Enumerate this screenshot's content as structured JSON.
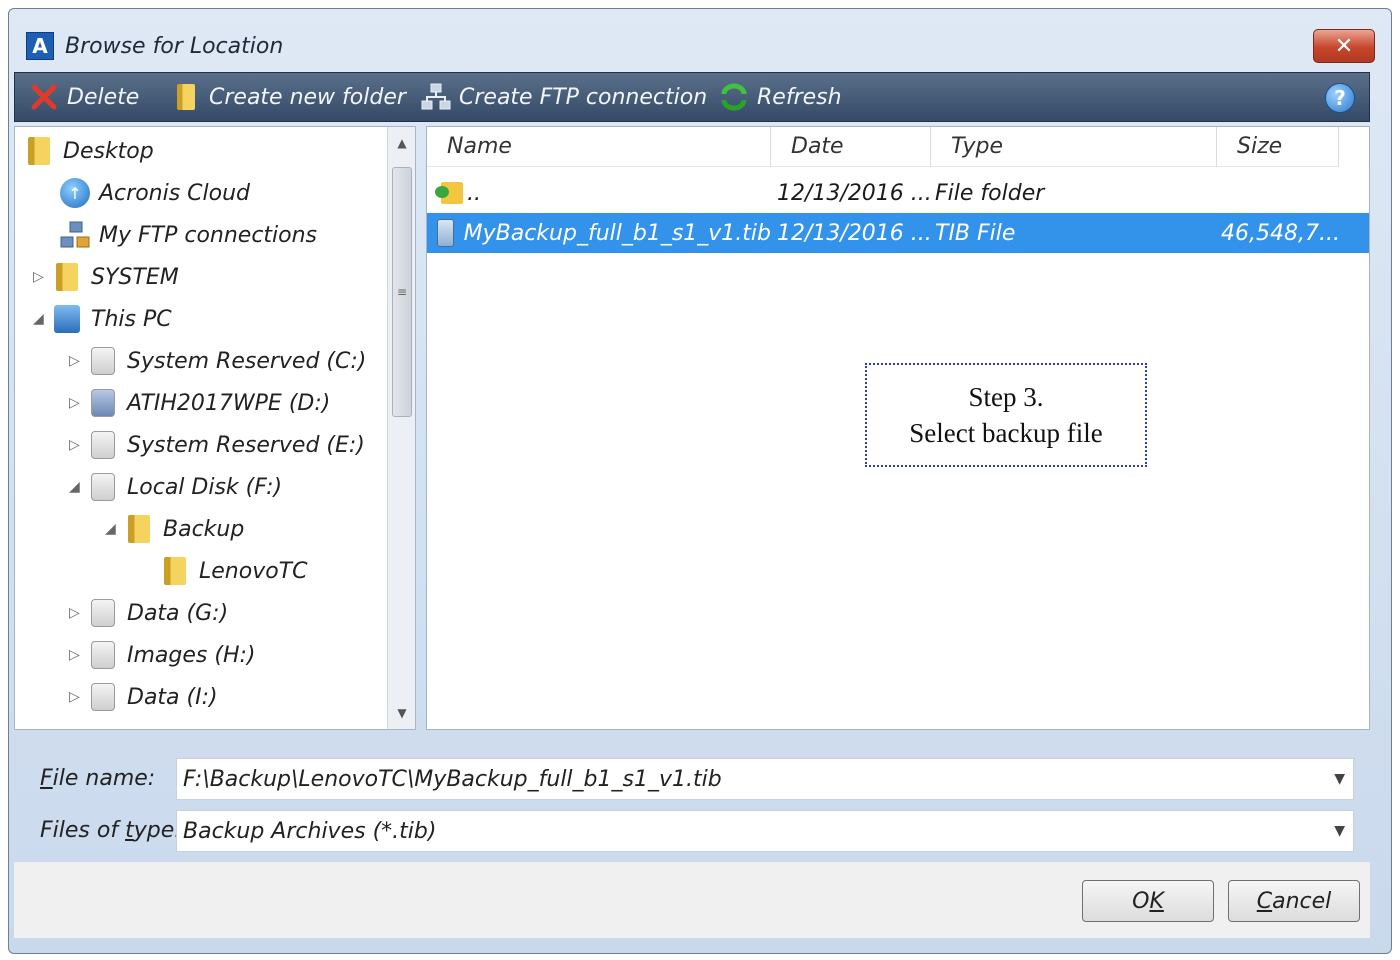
{
  "window": {
    "title": "Browse for Location",
    "app_icon_letter": "A",
    "close_glyph": "✕"
  },
  "toolbar": {
    "delete_label": "Delete",
    "new_folder_label": "Create new folder",
    "ftp_label": "Create FTP connection",
    "refresh_label": "Refresh",
    "help_glyph": "?"
  },
  "tree": {
    "items": [
      {
        "label": "Desktop",
        "icon": "folder-icon",
        "expander": ""
      },
      {
        "label": "Acronis Cloud",
        "icon": "cloud-icon",
        "expander": ""
      },
      {
        "label": "My FTP connections",
        "icon": "ftp-icon",
        "expander": ""
      },
      {
        "label": "SYSTEM",
        "icon": "folder-icon",
        "expander": "▷"
      },
      {
        "label": "This PC",
        "icon": "computer-icon",
        "expander": "◢"
      },
      {
        "label": "System Reserved (C:)",
        "icon": "drive-icon",
        "expander": "▷"
      },
      {
        "label": "ATIH2017WPE (D:)",
        "icon": "drive-icon",
        "expander": "▷"
      },
      {
        "label": "System Reserved (E:)",
        "icon": "drive-icon",
        "expander": "▷"
      },
      {
        "label": "Local Disk (F:)",
        "icon": "drive-icon",
        "expander": "◢"
      },
      {
        "label": "Backup",
        "icon": "folder-icon",
        "expander": "◢"
      },
      {
        "label": "LenovoTC",
        "icon": "folder-icon",
        "expander": ""
      },
      {
        "label": "Data (G:)",
        "icon": "drive-icon",
        "expander": "▷"
      },
      {
        "label": "Images (H:)",
        "icon": "drive-icon",
        "expander": "▷"
      },
      {
        "label": "Data (I:)",
        "icon": "drive-icon",
        "expander": "▷"
      }
    ],
    "scroll_up_glyph": "▲",
    "scroll_down_glyph": "▼",
    "thumb_grip": "≡"
  },
  "files": {
    "columns": [
      "Name",
      "Date",
      "Type",
      "Size"
    ],
    "rows": [
      {
        "name": "..",
        "date": "12/13/2016 ...",
        "type": "File folder",
        "size": "",
        "icon": "folder-up-icon",
        "selected": false
      },
      {
        "name": "MyBackup_full_b1_s1_v1.tib",
        "date": "12/13/2016 ...",
        "type": "TIB File",
        "size": "46,548,7...",
        "icon": "tib-file-icon",
        "selected": true
      }
    ]
  },
  "callout": {
    "line1": "Step 3.",
    "line2": "Select backup file"
  },
  "form": {
    "file_name_label_mnemonic": "F",
    "file_name_label_rest": "ile name:",
    "file_name_value": "F:\\Backup\\LenovoTC\\MyBackup_full_b1_s1_v1.tib",
    "file_type_label_pre": "Files of ",
    "file_type_label_mnemonic": "t",
    "file_type_label_rest": "ype:",
    "file_type_value": "Backup Archives (*.tib)",
    "dropdown_glyph": "▼"
  },
  "buttons": {
    "ok_pre": "O",
    "ok_mnemonic": "K",
    "cancel_mnemonic": "C",
    "cancel_rest": "ancel"
  },
  "colors": {
    "selection": "#3393ea",
    "toolbar": "#455a76",
    "callout_border": "#2a3bd6"
  }
}
